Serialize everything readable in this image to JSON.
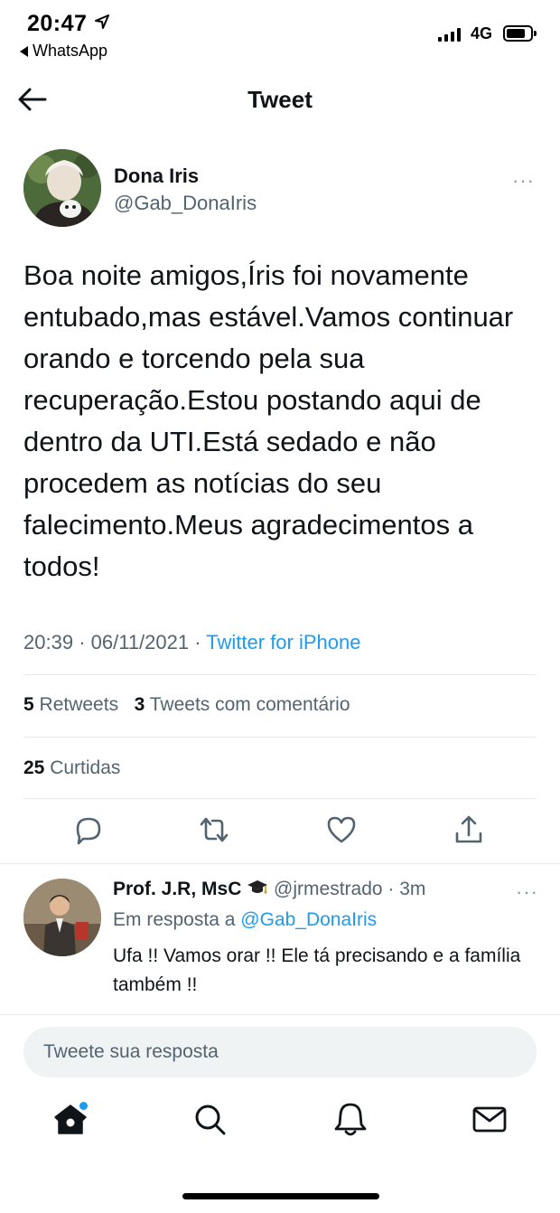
{
  "status_bar": {
    "time": "20:47",
    "back_app": "WhatsApp",
    "network": "4G"
  },
  "header": {
    "title": "Tweet"
  },
  "tweet": {
    "author_name": "Dona Iris",
    "author_handle": "@Gab_DonaIris",
    "more_label": "···",
    "text": "Boa noite amigos,Íris foi novamente entubado,mas estável.Vamos continuar orando e torcendo pela sua recuperação.Estou postando aqui de dentro da UTI.Está sedado e não procedem as notícias do seu falecimento.Meus agradecimentos a todos!",
    "time": "20:39",
    "date": "06/11/2021",
    "source": "Twitter for iPhone",
    "retweets_count": "5",
    "retweets_label": "Retweets",
    "quotes_count": "3",
    "quotes_label": "Tweets com comentário",
    "likes_count": "25",
    "likes_label": "Curtidas"
  },
  "actions": {
    "icons": [
      "reply-icon",
      "retweet-icon",
      "like-icon",
      "share-icon"
    ]
  },
  "reply": {
    "name": "Prof. J.R, MsC",
    "badge_icon": "graduation-cap-icon",
    "handle": "@jrmestrado",
    "time": "3m",
    "more_label": "···",
    "reply_to_label": "Em resposta a",
    "reply_to_handle": "@Gab_DonaIris",
    "text": "Ufa !! Vamos orar !! Ele tá precisando e a família também !!"
  },
  "compose": {
    "placeholder": "Tweete sua resposta"
  },
  "tabbar": {
    "items": [
      "home-icon",
      "search-icon",
      "notifications-icon",
      "messages-icon"
    ]
  },
  "colors": {
    "accent": "#1d9bf0",
    "text_primary": "#0f1419",
    "text_secondary": "#536471"
  }
}
